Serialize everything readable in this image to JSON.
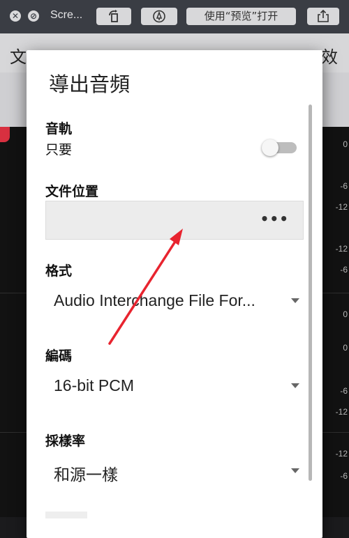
{
  "toolbar": {
    "close_icon": "close-icon",
    "minimize_icon": "minimize-icon",
    "title": "Scre...",
    "rotate_icon": "rotate-left-icon",
    "markup_icon": "markup-pen-icon",
    "open_with_preview_label": "使用“预览”打开",
    "share_icon": "share-icon"
  },
  "background_app": {
    "menu_text_left": "文",
    "menu_text_right": "效",
    "db_labels": [
      "0",
      "-6",
      "-12",
      "-12",
      "-6",
      "0",
      "0",
      "-6",
      "-12",
      "-12",
      "-6"
    ],
    "red_marker_color": "#d83040"
  },
  "dialog": {
    "title": "導出音頻",
    "track_section": {
      "label": "音軌",
      "option_text": "只要",
      "toggle_on": false
    },
    "file_location": {
      "label": "文件位置",
      "value": "",
      "browse_label": "•••"
    },
    "format": {
      "label": "格式",
      "value": "Audio Interchange File For..."
    },
    "encoding": {
      "label": "編碼",
      "value": "16-bit PCM"
    },
    "sample_rate": {
      "label": "採樣率",
      "value": "和源一樣"
    }
  },
  "annotation": {
    "arrow_color": "#e8242f"
  }
}
